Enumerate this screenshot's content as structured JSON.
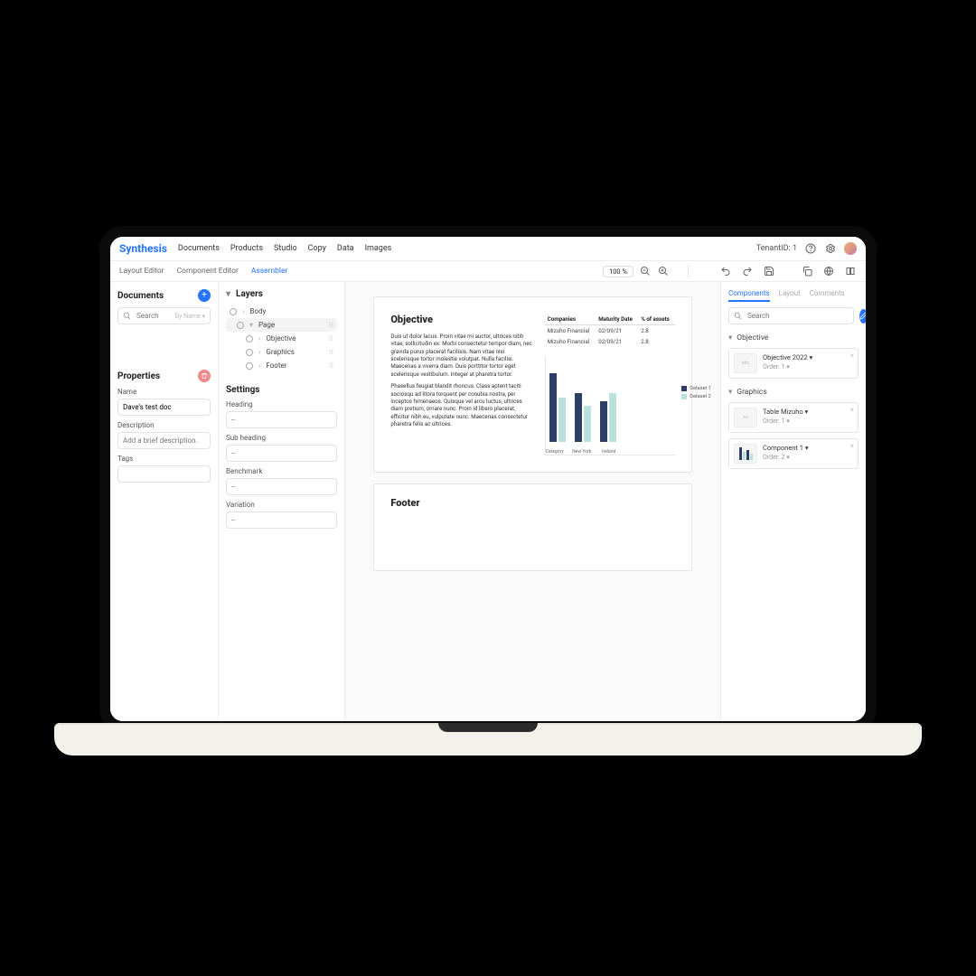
{
  "brand": "Synthesis",
  "topnav": {
    "items": [
      "Documents",
      "Products",
      "Studio",
      "Copy",
      "Data",
      "Images"
    ],
    "tenant": "TenantID: 1"
  },
  "subbar": {
    "tabs": [
      "Layout Editor",
      "Component Editor",
      "Assembler"
    ],
    "active_index": 2,
    "zoom": "100 %"
  },
  "documents": {
    "title": "Documents",
    "search_placeholder": "Search",
    "search_hint": "By Name ▾"
  },
  "properties": {
    "title": "Properties",
    "name_label": "Name",
    "name_value": "Dave's test doc",
    "desc_label": "Description",
    "desc_placeholder": "Add a brief description.",
    "tags_label": "Tags"
  },
  "layers": {
    "title": "Layers",
    "items": [
      {
        "label": "Body",
        "depth": 0,
        "expand": ">"
      },
      {
        "label": "Page",
        "depth": 1,
        "expand": "v",
        "selected": true
      },
      {
        "label": "Objective",
        "depth": 2,
        "expand": ">"
      },
      {
        "label": "Graphics",
        "depth": 2,
        "expand": ">"
      },
      {
        "label": "Footer",
        "depth": 2,
        "expand": ">"
      }
    ]
  },
  "settings": {
    "title": "Settings",
    "fields": [
      "Heading",
      "Sub heading",
      "Benchmark",
      "Variation"
    ],
    "placeholder": "--"
  },
  "canvas": {
    "objective_title": "Objective",
    "lorem1": "Duis ut dolor lacus. Proin vitae mi auctor, ultrices nibh vitae, sollicitudin ex. Morbi consectetur tempor diam, nec gravida purus placerat facilisis. Nam vitae nisi scelerisque tortor molestie volutpat. Nulla facilisi. Maecenas a viverra diam. Duis porttitor tortor eget scelerisque vestibulum. Integer at pharetra tortor.",
    "lorem2": "Phasellus feugiat blandit rhoncus. Class aptent taciti sociosqu ad litora torquent per conubia nostra, per inceptos himenaeos. Quisque vel arcu luctus, ultrices diam pretium, ornare nunc. Proin id libero placerat, efficitur nibh eu, vulputate nunc. Maecenas consectetur pharetra felis ac ultrices.",
    "table": {
      "headers": [
        "Companies",
        "Maturity Date",
        "% of assets"
      ],
      "rows": [
        [
          "Mizuho Financial",
          "02/09/21",
          "2.8"
        ],
        [
          "Mizuho Financial",
          "02/09/21",
          "2.8"
        ]
      ]
    },
    "footer_title": "Footer"
  },
  "chart_data": {
    "type": "bar",
    "categories": [
      "Category",
      "New York",
      "Ireland"
    ],
    "series": [
      {
        "name": "Dataset 1",
        "color": "#2c3e66",
        "values": [
          85,
          60,
          50
        ]
      },
      {
        "name": "Dataset 2",
        "color": "#b9e3da",
        "values": [
          55,
          45,
          60
        ]
      }
    ],
    "ylim": [
      0,
      100
    ]
  },
  "rightpanel": {
    "tabs": [
      "Components",
      "Layout",
      "Comments"
    ],
    "active_index": 0,
    "search_placeholder": "Search",
    "sections": [
      {
        "title": "Objective",
        "cards": [
          {
            "title": "Objective 2022",
            "order": "Order: 1",
            "thumb": "text"
          }
        ]
      },
      {
        "title": "Graphics",
        "cards": [
          {
            "title": "Table Mizuho",
            "order": "Order: 1",
            "thumb": "table"
          },
          {
            "title": "Component 1",
            "order": "Order: 2",
            "thumb": "chart"
          }
        ]
      }
    ]
  }
}
